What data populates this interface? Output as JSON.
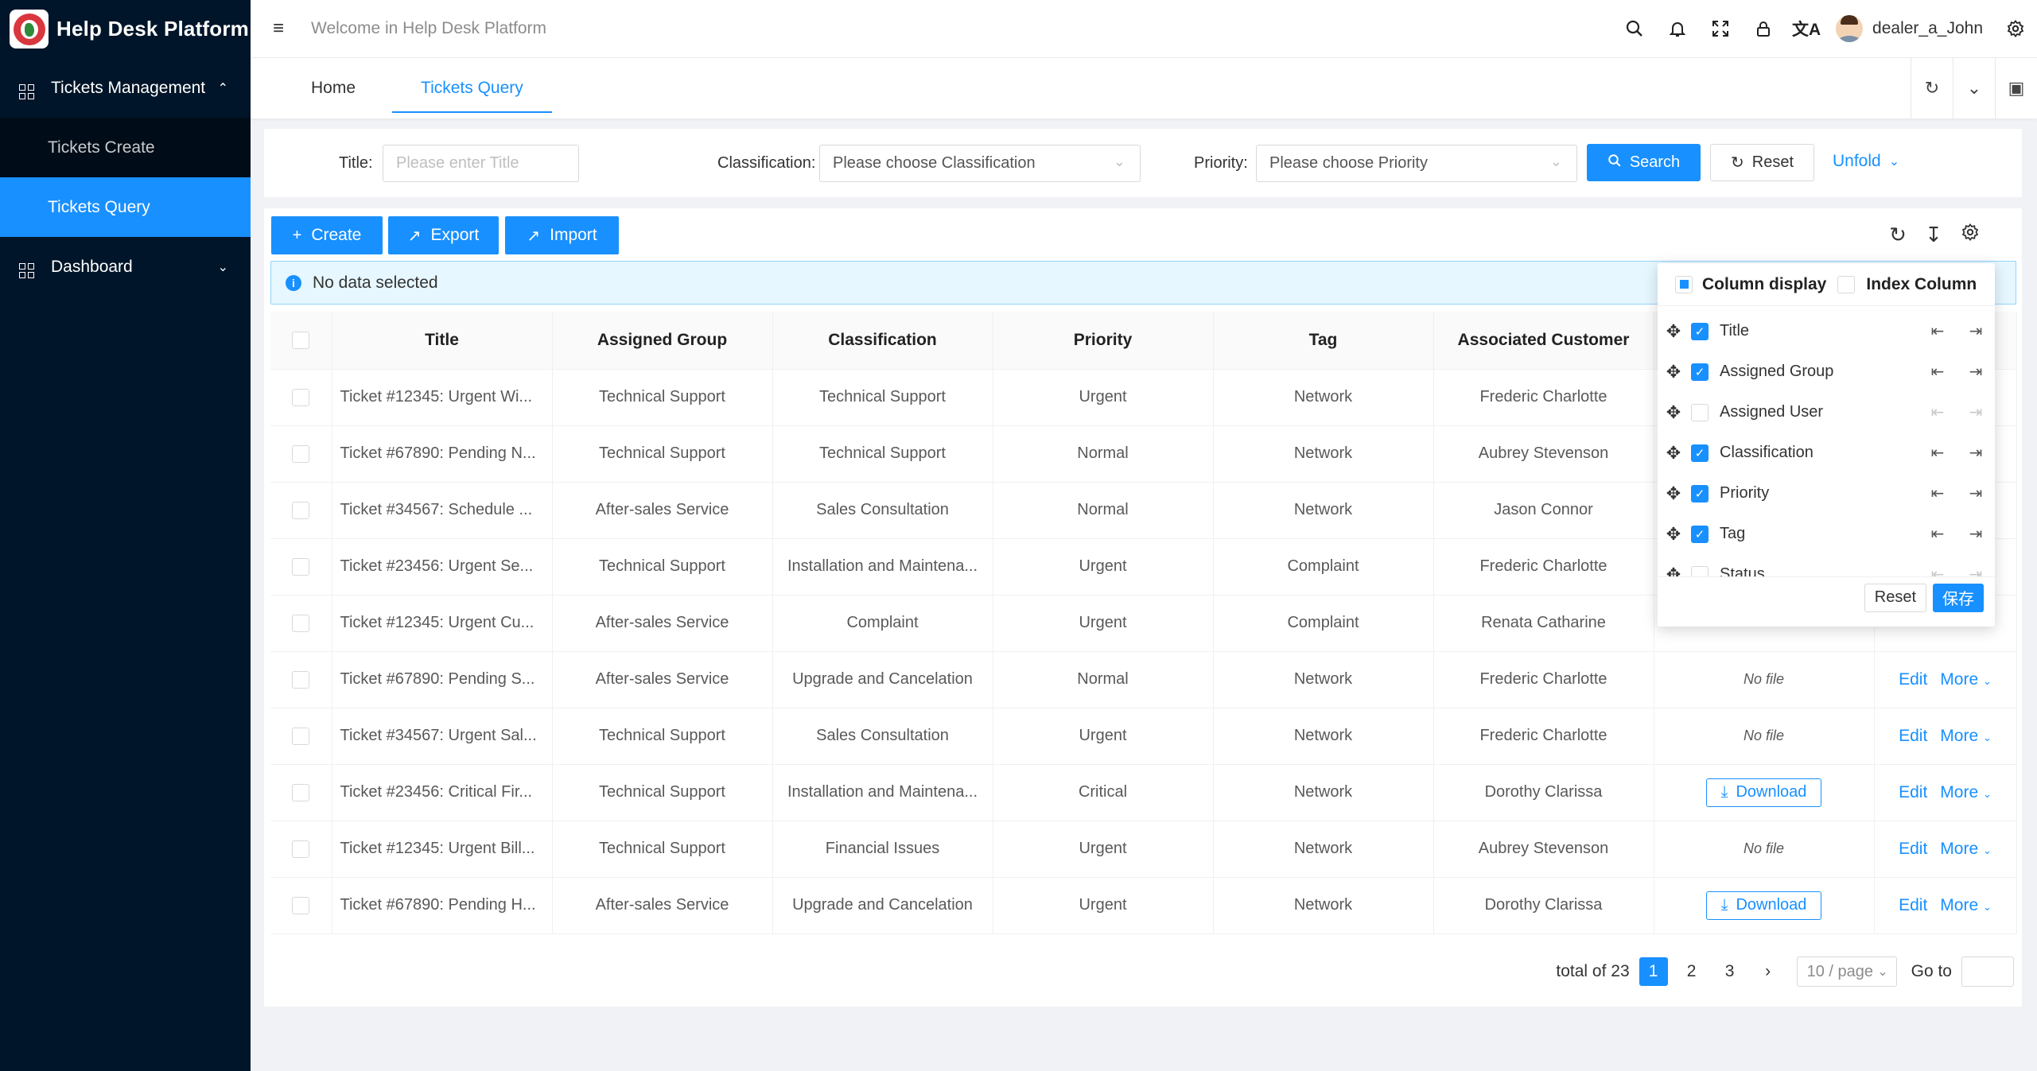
{
  "app": {
    "title": "Help Desk Platform",
    "welcome": "Welcome in Help Desk Platform",
    "username": "dealer_a_John"
  },
  "sidebar": {
    "group1": {
      "label": "Tickets Management",
      "items": [
        "Tickets Create",
        "Tickets Query"
      ]
    },
    "group2": {
      "label": "Dashboard"
    }
  },
  "tabs": [
    "Home",
    "Tickets Query"
  ],
  "search": {
    "title_label": "Title",
    "title_placeholder": "Please enter Title",
    "classification_label": "Classification",
    "classification_placeholder": "Please choose Classification",
    "priority_label": "Priority",
    "priority_placeholder": "Please choose Priority",
    "search_btn": "Search",
    "reset_btn": "Reset",
    "unfold_btn": "Unfold"
  },
  "toolbar": {
    "create": "Create",
    "export": "Export",
    "import": "Import"
  },
  "alert": "No data selected",
  "table": {
    "columns": [
      "Title",
      "Assigned Group",
      "Classification",
      "Priority",
      "Tag",
      "Associated Customer"
    ],
    "rows": [
      {
        "title": "Ticket #12345: Urgent Wi...",
        "group": "Technical Support",
        "classification": "Technical Support",
        "priority": "Urgent",
        "tag": "Network",
        "customer": "Frederic Charlotte",
        "file": "",
        "file_type": "none",
        "edit": "",
        "more": ""
      },
      {
        "title": "Ticket #67890: Pending N...",
        "group": "Technical Support",
        "classification": "Technical Support",
        "priority": "Normal",
        "tag": "Network",
        "customer": "Aubrey Stevenson",
        "file": "",
        "file_type": "none",
        "edit": "",
        "more": ""
      },
      {
        "title": "Ticket #34567: Schedule ...",
        "group": "After-sales Service",
        "classification": "Sales Consultation",
        "priority": "Normal",
        "tag": "Network",
        "customer": "Jason Connor",
        "file": "",
        "file_type": "none",
        "edit": "",
        "more": ""
      },
      {
        "title": "Ticket #23456: Urgent Se...",
        "group": "Technical Support",
        "classification": "Installation and Maintena...",
        "priority": "Urgent",
        "tag": "Complaint",
        "customer": "Frederic Charlotte",
        "file": "",
        "file_type": "none",
        "edit": "",
        "more": ""
      },
      {
        "title": "Ticket #12345: Urgent Cu...",
        "group": "After-sales Service",
        "classification": "Complaint",
        "priority": "Urgent",
        "tag": "Complaint",
        "customer": "Renata Catharine",
        "file": "",
        "file_type": "none",
        "edit": "",
        "more": ""
      },
      {
        "title": "Ticket #67890: Pending S...",
        "group": "After-sales Service",
        "classification": "Upgrade and Cancelation",
        "priority": "Normal",
        "tag": "Network",
        "customer": "Frederic Charlotte",
        "file": "No file",
        "file_type": "nofile",
        "edit": "Edit",
        "more": "More"
      },
      {
        "title": "Ticket #34567: Urgent Sal...",
        "group": "Technical Support",
        "classification": "Sales Consultation",
        "priority": "Urgent",
        "tag": "Network",
        "customer": "Frederic Charlotte",
        "file": "No file",
        "file_type": "nofile",
        "edit": "Edit",
        "more": "More"
      },
      {
        "title": "Ticket #23456: Critical Fir...",
        "group": "Technical Support",
        "classification": "Installation and Maintena...",
        "priority": "Critical",
        "tag": "Network",
        "customer": "Dorothy Clarissa",
        "file": "Download",
        "file_type": "download",
        "edit": "Edit",
        "more": "More"
      },
      {
        "title": "Ticket #12345: Urgent Bill...",
        "group": "Technical Support",
        "classification": "Financial Issues",
        "priority": "Urgent",
        "tag": "Network",
        "customer": "Aubrey Stevenson",
        "file": "No file",
        "file_type": "nofile",
        "edit": "Edit",
        "more": "More"
      },
      {
        "title": "Ticket #67890: Pending H...",
        "group": "After-sales Service",
        "classification": "Upgrade and Cancelation",
        "priority": "Urgent",
        "tag": "Network",
        "customer": "Dorothy Clarissa",
        "file": "Download",
        "file_type": "download",
        "edit": "Edit",
        "more": "More"
      }
    ]
  },
  "pagination": {
    "total": "total of 23",
    "pages": [
      "1",
      "2",
      "3"
    ],
    "current": "1",
    "page_size": "10 / page",
    "goto_label": "Go to"
  },
  "column_settings": {
    "column_display": "Column display",
    "index_column": "Index Column",
    "items": [
      {
        "label": "Title",
        "checked": true
      },
      {
        "label": "Assigned Group",
        "checked": true
      },
      {
        "label": "Assigned User",
        "checked": false
      },
      {
        "label": "Classification",
        "checked": true
      },
      {
        "label": "Priority",
        "checked": true
      },
      {
        "label": "Tag",
        "checked": true
      },
      {
        "label": "Status",
        "checked": false
      }
    ],
    "reset": "Reset",
    "save": "保存"
  },
  "colors": {
    "primary": "#1890ff",
    "sidebar": "#001529",
    "submenu": "#000c17"
  }
}
